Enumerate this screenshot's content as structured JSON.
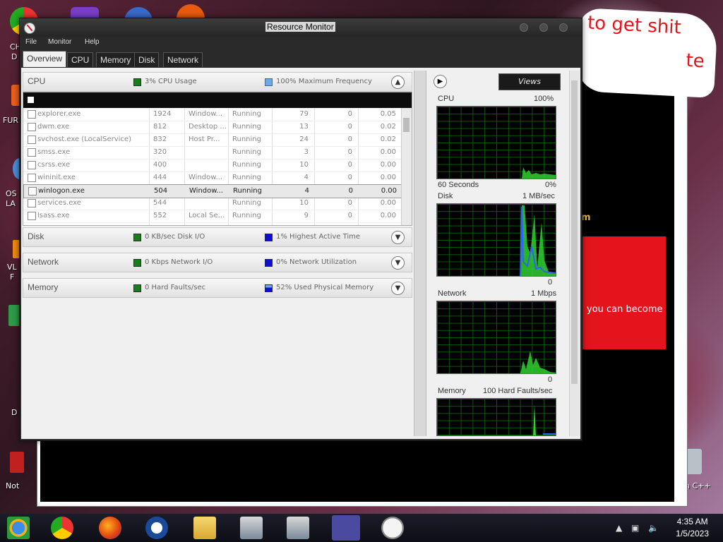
{
  "window": {
    "title": "Resource Monitor",
    "menu": [
      "File",
      "Monitor",
      "Help"
    ],
    "tabs": [
      "Overview",
      "CPU",
      "Memory",
      "Disk",
      "Network"
    ],
    "active_tab": "Overview"
  },
  "sections": {
    "cpu": {
      "name": "CPU",
      "ind1": "3% CPU Usage",
      "ind2": "100% Maximum Frequency"
    },
    "disk": {
      "name": "Disk",
      "ind1": "0 KB/sec Disk I/O",
      "ind2": "1% Highest Active Time"
    },
    "network": {
      "name": "Network",
      "ind1": "0 Kbps Network I/O",
      "ind2": "0% Network Utilization"
    },
    "memory": {
      "name": "Memory",
      "ind1": "0 Hard Faults/sec",
      "ind2": "52% Used Physical Memory"
    }
  },
  "processes": [
    {
      "image": "explorer.exe",
      "pid": "1924",
      "desc": "Window...",
      "status": "Running",
      "threads": "79",
      "cpu": "0",
      "avg": "0.05"
    },
    {
      "image": "dwm.exe",
      "pid": "812",
      "desc": "Desktop ...",
      "status": "Running",
      "threads": "13",
      "cpu": "0",
      "avg": "0.02"
    },
    {
      "image": "svchost.exe (LocalService)",
      "pid": "832",
      "desc": "Host Pr...",
      "status": "Running",
      "threads": "24",
      "cpu": "0",
      "avg": "0.02"
    },
    {
      "image": "smss.exe",
      "pid": "320",
      "desc": "",
      "status": "Running",
      "threads": "3",
      "cpu": "0",
      "avg": "0.00"
    },
    {
      "image": "csrss.exe",
      "pid": "400",
      "desc": "",
      "status": "Running",
      "threads": "10",
      "cpu": "0",
      "avg": "0.00"
    },
    {
      "image": "wininit.exe",
      "pid": "444",
      "desc": "Window...",
      "status": "Running",
      "threads": "4",
      "cpu": "0",
      "avg": "0.00"
    },
    {
      "image": "winlogon.exe",
      "pid": "504",
      "desc": "Window...",
      "status": "Running",
      "threads": "4",
      "cpu": "0",
      "avg": "0.00"
    },
    {
      "image": "services.exe",
      "pid": "544",
      "desc": "",
      "status": "Running",
      "threads": "10",
      "cpu": "0",
      "avg": "0.00"
    },
    {
      "image": "lsass.exe",
      "pid": "552",
      "desc": "Local Se...",
      "status": "Running",
      "threads": "9",
      "cpu": "0",
      "avg": "0.00"
    }
  ],
  "selected_row": 6,
  "right_panel": {
    "views_label": "Views",
    "graphs": [
      {
        "name": "CPU",
        "max": "100%",
        "foot_left": "60 Seconds",
        "foot_right": "0%"
      },
      {
        "name": "Disk",
        "max": "1 MB/sec",
        "foot_left": "",
        "foot_right": "0"
      },
      {
        "name": "Network",
        "max": "1 Mbps",
        "foot_left": "",
        "foot_right": "0"
      },
      {
        "name": "Memory",
        "max": "100 Hard Faults/sec",
        "foot_left": "",
        "foot_right": ""
      }
    ]
  },
  "background_window": {
    "cloud_text1": "to get shit",
    "cloud_text2": "te",
    "side_text": "m",
    "red_text": "you can become"
  },
  "desktop_labels": [
    "CH",
    "D",
    "FUR",
    "OS",
    "LA",
    "VL",
    "F",
    "D",
    "Not",
    "n C++"
  ],
  "taskbar": {
    "time": "4:35 AM",
    "date": "1/5/2023"
  },
  "colors": {
    "indicator_green": "#1e7a1e",
    "indicator_blue_light": "#6fa8e8",
    "indicator_blue": "#1010c8",
    "graph_green": "#30d030",
    "graph_blue": "#3060ff"
  }
}
